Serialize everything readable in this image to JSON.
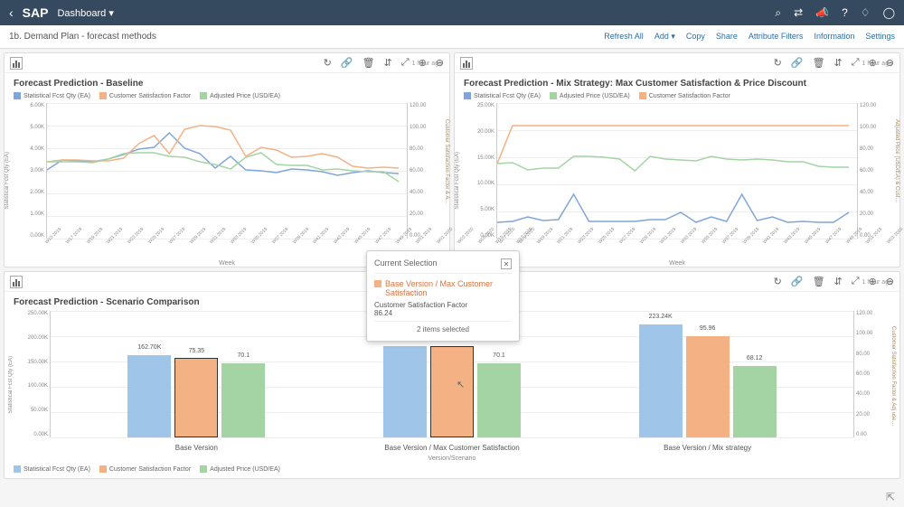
{
  "topbar": {
    "logo": "SAP",
    "title": "Dashboard",
    "icons": [
      "search-icon",
      "route-icon",
      "megaphone-icon",
      "help-icon",
      "bell-icon",
      "user-icon"
    ]
  },
  "subbar": {
    "breadcrumb": "1b. Demand Plan - forecast methods",
    "actions": [
      "Refresh All",
      "Add",
      "Copy",
      "Share",
      "Attribute Filters",
      "Information",
      "Settings"
    ]
  },
  "timestamp": "1 hour ago",
  "panel_tools": [
    "↻",
    "🔗",
    "🗑",
    "⇵",
    "⤢",
    "🔍",
    "🔎"
  ],
  "legend": {
    "series1": {
      "name": "Statistical Fcst Qty (EA)",
      "color": "#7fa6d9"
    },
    "series2": {
      "name": "Customer Satisfaction Factor",
      "color": "#f4b183"
    },
    "series3": {
      "name": "Adjusted Price (USD/EA)",
      "color": "#a4d4a4"
    }
  },
  "legend2": {
    "series1": {
      "name": "Statistical Fcst Qty (EA)",
      "color": "#7fa6d9"
    },
    "series2": {
      "name": "Adjusted Price (USD/EA)",
      "color": "#a4d4a4"
    },
    "series3": {
      "name": "Customer Satisfaction Factor",
      "color": "#f4b183"
    }
  },
  "chart1": {
    "title": "Forecast Prediction - Baseline",
    "xlabel": "Week",
    "ylabel_left": "Statistical Fcst Qty (EA)",
    "ylabel_right": "Customer Satisfaction Factor & A…",
    "y_left_ticks": [
      "6.00K",
      "5.00K",
      "4.00K",
      "3.00K",
      "2.00K",
      "1.00K",
      "0.00K"
    ],
    "y_right_ticks": [
      "120.00",
      "100.00",
      "80.00",
      "60.00",
      "40.00",
      "20.00",
      "0.00"
    ]
  },
  "chart2": {
    "title": "Forecast Prediction - Mix Strategy: Max Customer Satisfaction & Price Discount",
    "xlabel": "Week",
    "ylabel_left": "Statistical Fcst Qty (EA)",
    "ylabel_right": "Adjusted Price (USD/EA) & Cust…",
    "y_left_ticks": [
      "25.00K",
      "20.00K",
      "15.00K",
      "10.00K",
      "5.00K",
      "0.00K"
    ],
    "y_right_ticks": [
      "120.00",
      "100.00",
      "80.00",
      "60.00",
      "40.00",
      "20.00",
      "0.00"
    ]
  },
  "chart3": {
    "title": "Forecast Prediction - Scenario Comparison",
    "xlabel": "Version/Scenario",
    "ylabel_left": "Statistical Fcst Qty (EA)",
    "ylabel_right": "Customer Satisfaction Factor & Adj use…",
    "y_left_ticks": [
      "250.00K",
      "200.00K",
      "150.00K",
      "100.00K",
      "50.00K",
      "0.00K"
    ],
    "y_right_ticks": [
      "120.00",
      "100.00",
      "80.00",
      "60.00",
      "40.00",
      "20.00",
      "0.00"
    ]
  },
  "tooltip": {
    "header": "Current Selection",
    "title": "Base Version / Max Customer Satisfaction",
    "label": "Customer Satisfaction Factor",
    "value": "86.24",
    "footer": "2 items selected"
  },
  "chart_data": [
    {
      "id": "chart1",
      "type": "line",
      "title": "Forecast Prediction - Baseline",
      "xlabel": "Week",
      "categories": [
        "W15 2019",
        "W17 2019",
        "W19 2019",
        "W21 2019",
        "W23 2019",
        "W25 2019",
        "W27 2019",
        "W29 2019",
        "W31 2019",
        "W33 2019",
        "W35 2019",
        "W37 2019",
        "W39 2019",
        "W41 2019",
        "W43 2019",
        "W45 2019",
        "W47 2019",
        "W49 2019",
        "W51 2019",
        "W01 2020",
        "W03 2020",
        "W05 2020",
        "W07 2020",
        "W09 2020"
      ],
      "y_left": {
        "label": "Statistical Fcst Qty (EA)",
        "range": [
          0,
          6000
        ]
      },
      "y_right": {
        "label": "Customer Satisfaction Factor & Adjusted Price",
        "range": [
          0,
          120
        ]
      },
      "series": [
        {
          "name": "Statistical Fcst Qty (EA)",
          "axis": "left",
          "color": "#7fa6d9",
          "values": [
            3020,
            3460,
            3440,
            3400,
            3500,
            3700,
            3940,
            4050,
            4700,
            4000,
            3740,
            3110,
            3630,
            3030,
            3000,
            2920,
            3080,
            3050,
            2970,
            2800,
            2910,
            2980,
            2900,
            2870
          ]
        },
        {
          "name": "Customer Satisfaction Factor",
          "axis": "right",
          "color": "#f4b183",
          "values": [
            68.25,
            69.12,
            69.58,
            68.5,
            68.9,
            70.9,
            83.87,
            91.55,
            75.0,
            97.14,
            99.87,
            99.27,
            95.57,
            72.42,
            80.96,
            78.76,
            71.93,
            72.59,
            75.08,
            71.64,
            63.75,
            62.08,
            63.04,
            62.0
          ]
        },
        {
          "name": "Adjusted Price (USD/EA)",
          "axis": "right",
          "color": "#a4d4a4",
          "values": [
            68.25,
            68.0,
            68.0,
            67.5,
            70.41,
            75.08,
            76.2,
            76.0,
            73.0,
            72.0,
            68.0,
            65.66,
            61.58,
            72.13,
            75.92,
            65.67,
            65.02,
            65.0,
            61.06,
            62.0,
            60.0,
            59.0,
            59.0,
            50.18
          ]
        }
      ]
    },
    {
      "id": "chart2",
      "type": "line",
      "title": "Forecast Prediction - Mix Strategy: Max Customer Satisfaction & Price Discount",
      "xlabel": "Week",
      "categories": [
        "W15 2019",
        "W17 2019",
        "W19 2019",
        "W21 2019",
        "W23 2019",
        "W25 2019",
        "W27 2019",
        "W29 2019",
        "W31 2019",
        "W33 2019",
        "W35 2019",
        "W37 2019",
        "W39 2019",
        "W41 2019",
        "W43 2019",
        "W45 2019",
        "W47 2019",
        "W49 2019",
        "W51 2019",
        "W01 2020",
        "W03 2020",
        "W05 2020",
        "W07 2020",
        "W09 2020"
      ],
      "y_left": {
        "label": "Statistical Fcst Qty (EA)",
        "range": [
          0,
          25000
        ]
      },
      "y_right": {
        "label": "Adjusted Price (USD/EA) & Customer Satisfaction Factor",
        "range": [
          0,
          120
        ]
      },
      "series": [
        {
          "name": "Statistical Fcst Qty (EA)",
          "axis": "left",
          "color": "#7fa6d9",
          "values": [
            3020,
            3100,
            3960,
            3340,
            3520,
            8170,
            3130,
            3190,
            3130,
            3100,
            3490,
            3450,
            4910,
            3060,
            4000,
            3206,
            8170,
            3340,
            3930,
            3000,
            3080,
            3070,
            3000,
            4910
          ]
        },
        {
          "name": "Customer Satisfaction Factor",
          "axis": "right",
          "color": "#f4b183",
          "values": [
            66.25,
            100,
            100,
            100,
            100,
            100,
            100,
            100,
            100,
            100,
            100,
            100,
            100,
            100,
            100,
            100,
            100,
            100,
            100,
            100,
            100,
            100,
            100,
            100
          ]
        },
        {
          "name": "Adjusted Price (USD/EA)",
          "axis": "right",
          "color": "#a4d4a4",
          "values": [
            66.29,
            67.49,
            60.91,
            62.02,
            62.75,
            73.12,
            73.16,
            71.61,
            70.73,
            60.12,
            73.14,
            70.08,
            69.43,
            69.12,
            72.49,
            70.55,
            69.97,
            70.58,
            69.93,
            68.19,
            68.0,
            63.74,
            63.0,
            63.09
          ]
        }
      ]
    },
    {
      "id": "chart3",
      "type": "bar",
      "title": "Forecast Prediction - Scenario Comparison",
      "xlabel": "Version/Scenario",
      "categories": [
        "Base Version",
        "Base Version / Max Customer Satisfaction",
        "Base Version / Mix strategy"
      ],
      "y_left": {
        "label": "Statistical Fcst Qty (EA)",
        "range": [
          0,
          250000
        ]
      },
      "y_right": {
        "label": "Customer Satisfaction Factor & Adj…",
        "range": [
          0,
          120
        ]
      },
      "series": [
        {
          "name": "Statistical Fcst Qty (EA)",
          "axis": "left",
          "color": "#9fc5e8",
          "values": [
            162700,
            179610,
            223240
          ]
        },
        {
          "name": "Customer Satisfaction Factor",
          "axis": "right",
          "color": "#f4b183",
          "values": [
            75.35,
            86.24,
            95.96
          ]
        },
        {
          "name": "Adjusted Price (USD/EA)",
          "axis": "right",
          "color": "#a4d4a4",
          "values": [
            70.1,
            70.1,
            68.12
          ]
        }
      ],
      "selected": {
        "category_index": 1,
        "series": "Customer Satisfaction Factor"
      }
    }
  ]
}
